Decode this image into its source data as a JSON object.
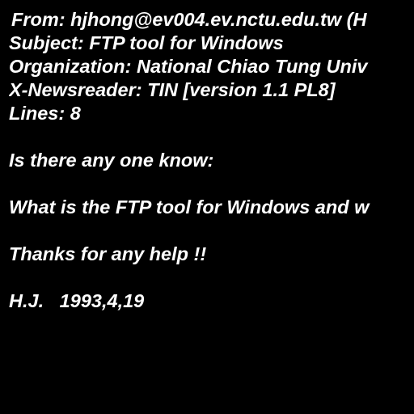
{
  "headers": {
    "from": "From: hjhong@ev004.ev.nctu.edu.tw (H",
    "subject": "Subject: FTP tool for Windows",
    "organization": "Organization: National Chiao Tung Univ",
    "newsreader": "X-Newsreader: TIN [version 1.1 PL8]",
    "lines": "Lines: 8"
  },
  "body": {
    "question_intro": "Is there any one know:",
    "question": "What is the FTP tool for Windows and w",
    "thanks": "Thanks for any help !!",
    "signature": "H.J.   1993,4,19"
  },
  "colors": {
    "background": "#000000",
    "text": "#ffffff"
  }
}
